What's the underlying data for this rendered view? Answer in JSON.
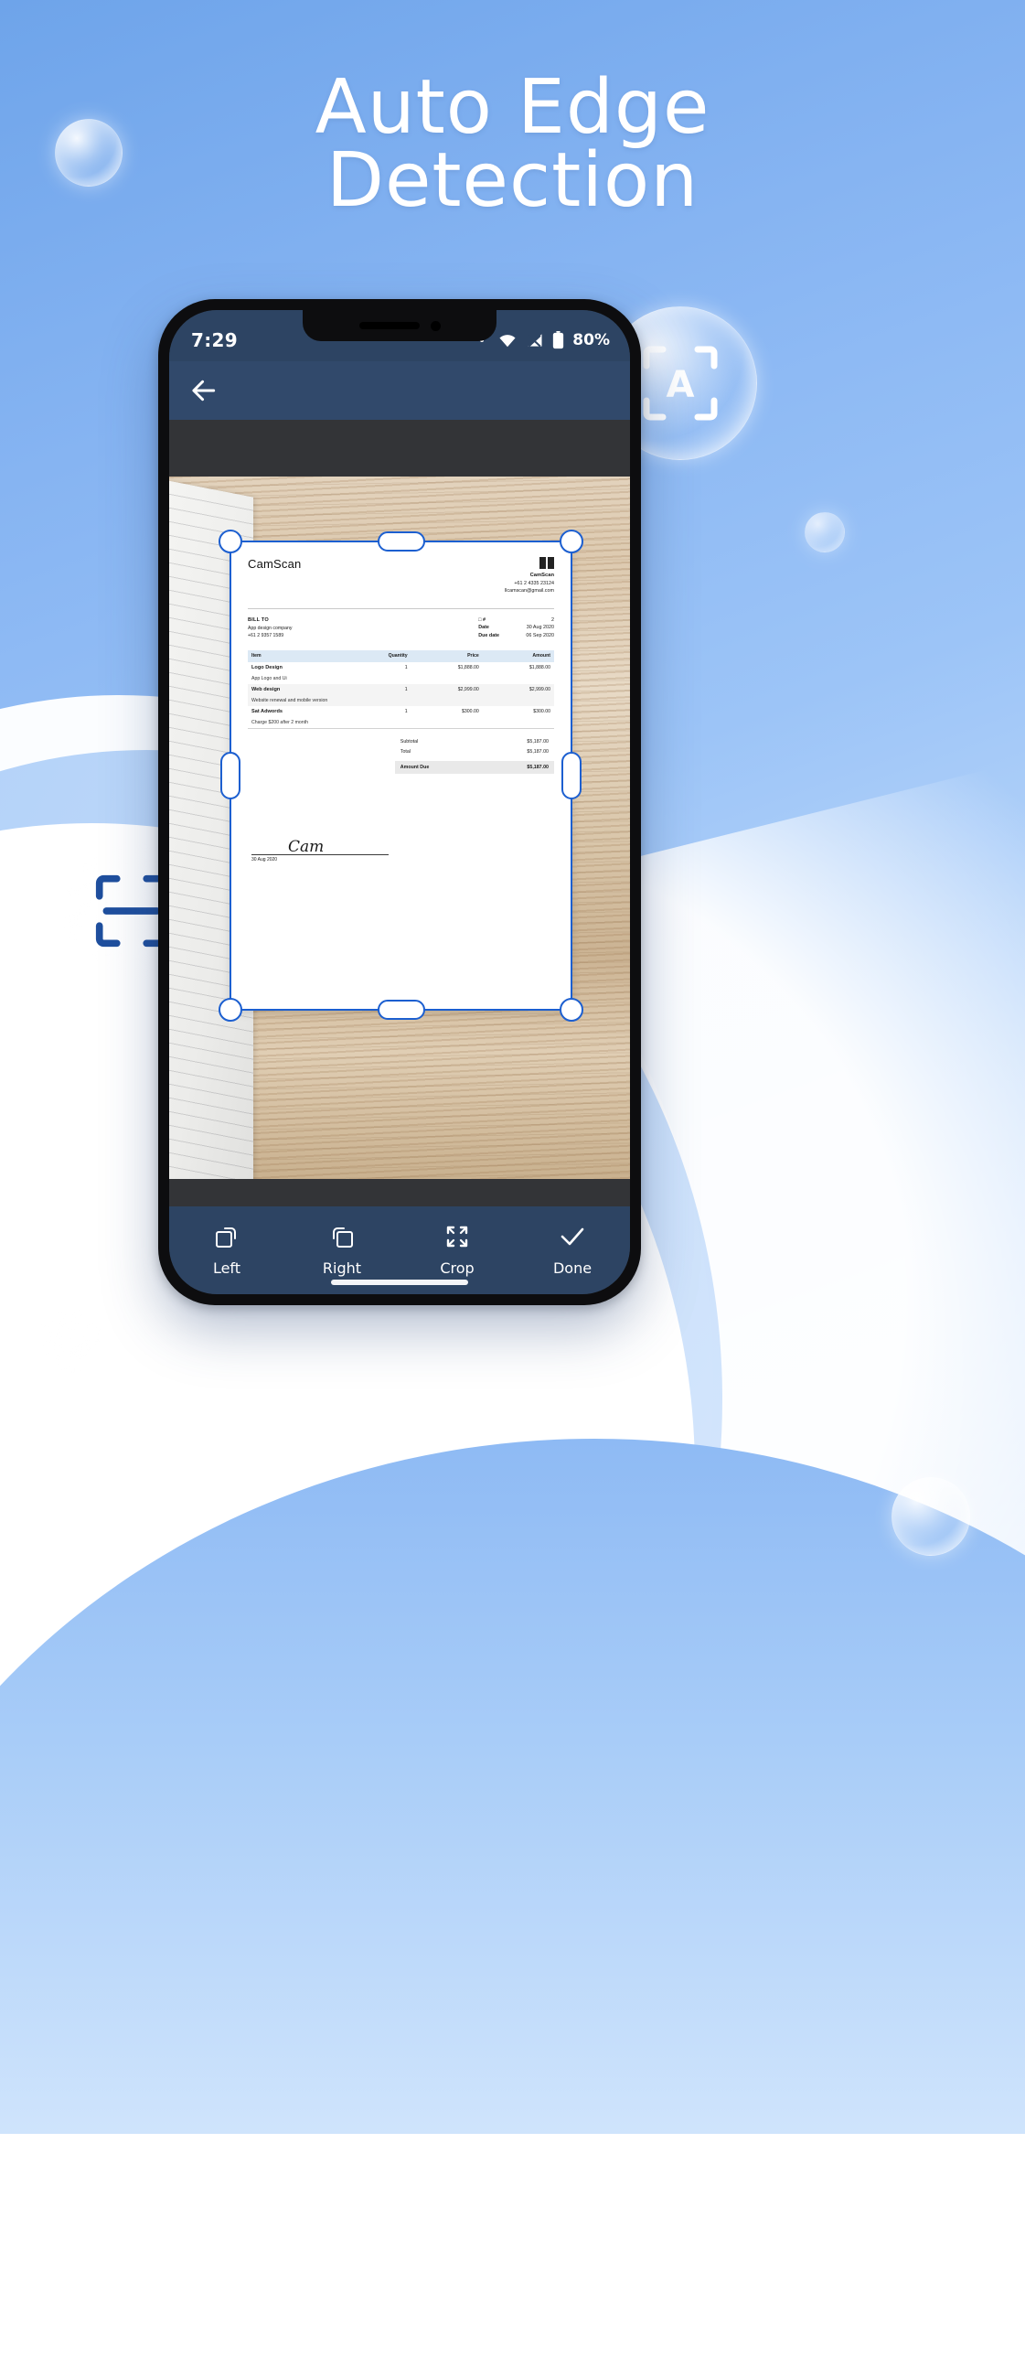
{
  "headline": {
    "line1": "Auto Edge",
    "line2": "Detection"
  },
  "status_bar": {
    "time": "7:29",
    "battery_percent": "80%",
    "icons": [
      "dot",
      "wifi-icon",
      "cellular-signal-icon",
      "battery-icon"
    ]
  },
  "app_bar": {
    "back_icon": "back-arrow-icon"
  },
  "decor": {
    "scan_badge_right": "auto-scan-text-icon",
    "scan_badge_left": "crop-scan-icon"
  },
  "crop_overlay": {
    "handles": [
      "top-left",
      "top-center",
      "top-right",
      "middle-left",
      "middle-right",
      "bottom-left",
      "bottom-center",
      "bottom-right"
    ],
    "border_color": "#1c5fd0"
  },
  "toolbar": {
    "items": [
      {
        "label": "Left",
        "icon": "rotate-left-icon"
      },
      {
        "label": "Right",
        "icon": "rotate-right-icon"
      },
      {
        "label": "Crop",
        "icon": "expand-crop-icon"
      },
      {
        "label": "Done",
        "icon": "check-icon"
      }
    ]
  },
  "document": {
    "brand": "CamScan",
    "qr_icon": "barcode-icon",
    "company": {
      "name": "CamScan",
      "phone": "+61 2 4335 23124",
      "email": "llcamscan@gmail.com"
    },
    "bill_to": {
      "heading": "BILL TO",
      "company": "App design company",
      "phone": "+61 2 9357 1589"
    },
    "meta": [
      {
        "label": "□ #",
        "value": "2"
      },
      {
        "label": "Date",
        "value": "30 Aug 2020"
      },
      {
        "label": "Due date",
        "value": "06 Sep 2020"
      }
    ],
    "table": {
      "headers": [
        "Item",
        "Quantity",
        "Price",
        "Amount"
      ],
      "rows": [
        {
          "name": "Logo Design",
          "desc": "App Logo and Ui",
          "quantity": "1",
          "price": "$1,888.00",
          "amount": "$1,888.00"
        },
        {
          "name": "Web design",
          "desc": "Website renewal and mobile version",
          "quantity": "1",
          "price": "$2,999.00",
          "amount": "$2,999.00"
        },
        {
          "name": "Sat Adwords",
          "desc": "Charge $200 after 2 month",
          "quantity": "1",
          "price": "$300.00",
          "amount": "$300.00"
        }
      ]
    },
    "totals": [
      {
        "label": "Subtotal",
        "value": "$5,187.00"
      },
      {
        "label": "Total",
        "value": "$5,187.00"
      },
      {
        "label": "Amount Due",
        "value": "$5,187.00"
      }
    ],
    "signature": {
      "mark": "Cam",
      "date": "30 Aug 2020"
    }
  }
}
